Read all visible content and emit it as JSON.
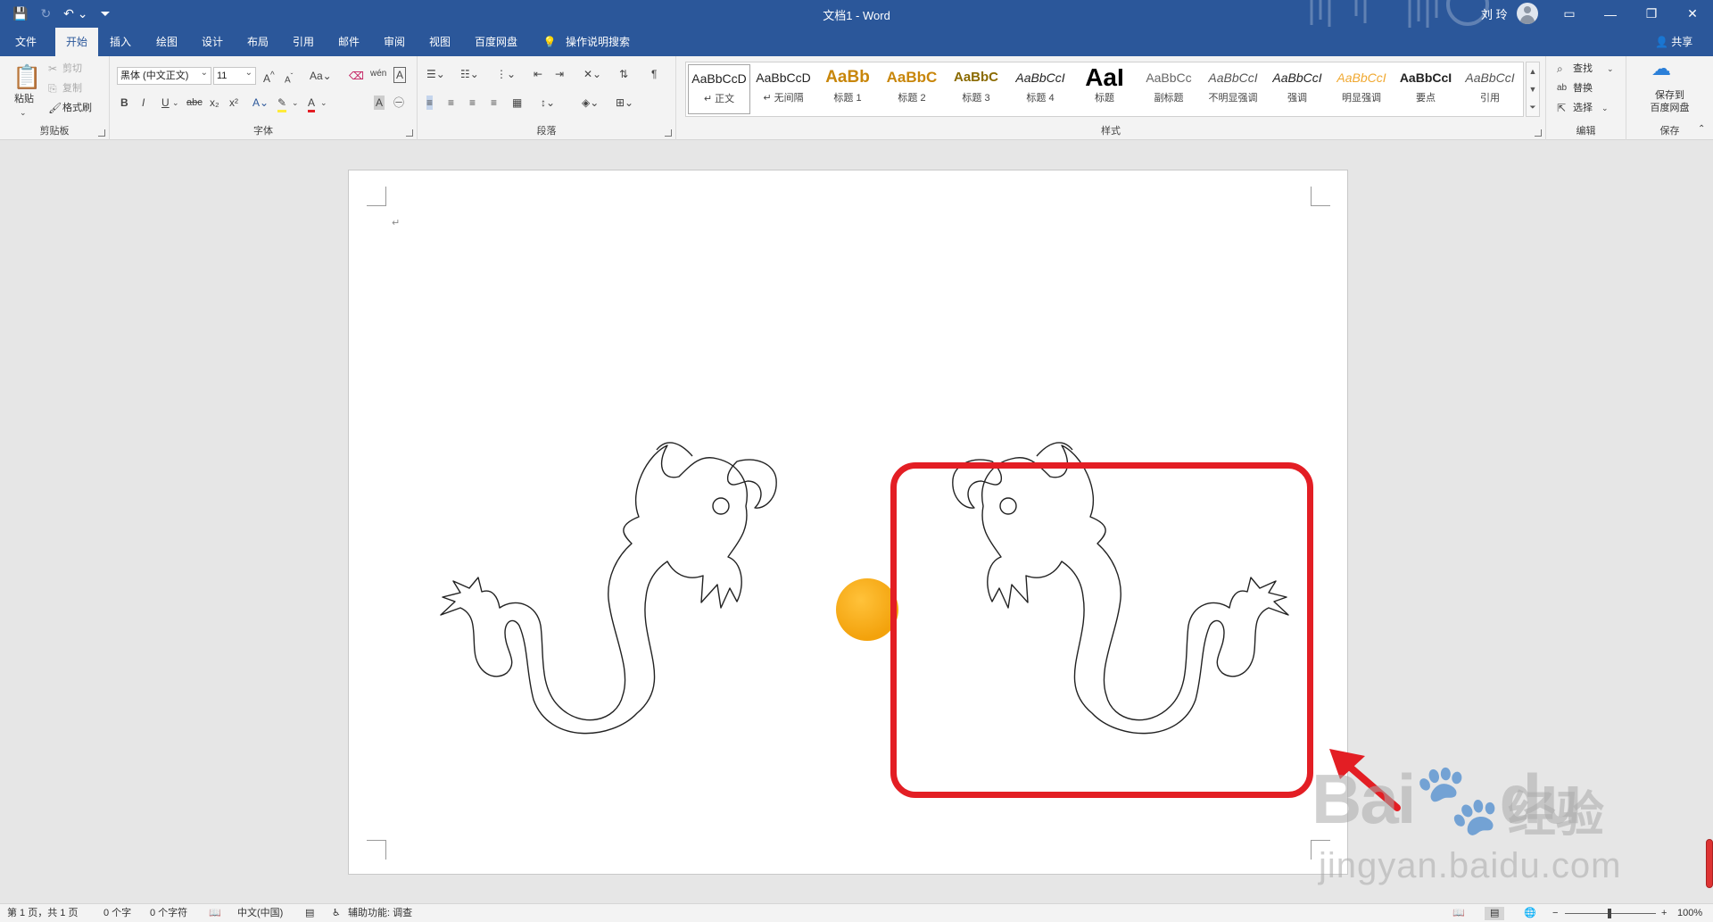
{
  "titlebar": {
    "title": "文档1  -  Word",
    "user": "刘 玲"
  },
  "tabs": [
    {
      "label": "文件"
    },
    {
      "label": "开始"
    },
    {
      "label": "插入"
    },
    {
      "label": "绘图"
    },
    {
      "label": "设计"
    },
    {
      "label": "布局"
    },
    {
      "label": "引用"
    },
    {
      "label": "邮件"
    },
    {
      "label": "审阅"
    },
    {
      "label": "视图"
    },
    {
      "label": "百度网盘"
    },
    {
      "label": "操作说明搜索"
    }
  ],
  "share_label": "共享",
  "clipboard": {
    "paste": "粘贴",
    "cut": "剪切",
    "copy": "复制",
    "format_painter": "格式刷",
    "group_label": "剪贴板"
  },
  "font": {
    "name": "黑体 (中文正文)",
    "size": "11",
    "group_label": "字体"
  },
  "paragraph": {
    "group_label": "段落"
  },
  "styles": {
    "group_label": "样式",
    "items": [
      {
        "preview": "AaBbCcD",
        "label": "↵ 正文"
      },
      {
        "preview": "AaBbCcD",
        "label": "↵ 无间隔"
      },
      {
        "preview": "AaBb",
        "label": "标题 1"
      },
      {
        "preview": "AaBbC",
        "label": "标题 2"
      },
      {
        "preview": "AaBbC",
        "label": "标题 3"
      },
      {
        "preview": "AaBbCcI",
        "label": "标题 4"
      },
      {
        "preview": "AaI",
        "label": "标题"
      },
      {
        "preview": "AaBbCc",
        "label": "副标题"
      },
      {
        "preview": "AaBbCcI",
        "label": "不明显强调"
      },
      {
        "preview": "AaBbCcI",
        "label": "强调"
      },
      {
        "preview": "AaBbCcI",
        "label": "明显强调"
      },
      {
        "preview": "AaBbCcI",
        "label": "要点"
      },
      {
        "preview": "AaBbCcI",
        "label": "引用"
      }
    ]
  },
  "editing": {
    "find": "查找",
    "replace": "替换",
    "select": "选择",
    "group_label": "编辑"
  },
  "save": {
    "button_line1": "保存到",
    "button_line2": "百度网盘",
    "group_label": "保存"
  },
  "statusbar": {
    "page": "第 1 页，共 1 页",
    "words": "0 个字",
    "chars": "0 个字符",
    "language": "中文(中国)",
    "accessibility": "辅助功能: 调查",
    "zoom": "100%"
  },
  "watermark": {
    "main": "Bai",
    "du": "du",
    "cn": "经验",
    "url": "jingyan.baidu.com"
  },
  "colors": {
    "accent": "#2b579a",
    "highlight": "#e31e24",
    "dot": "#f5a623"
  }
}
